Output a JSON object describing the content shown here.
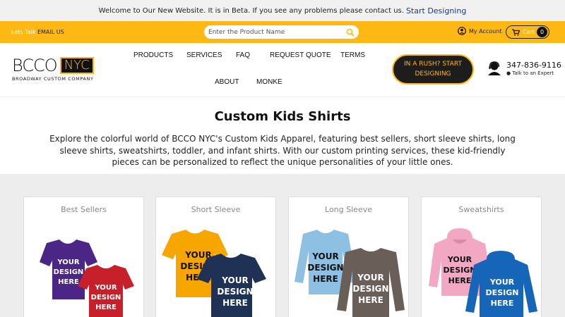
{
  "announcement": {
    "text": "Welcome to Our New Website. It is in Beta. If you see any problems please contact us.",
    "link": "Start Designing"
  },
  "utility": {
    "talk_prefix": "Lets Talk",
    "talk_link": "EMAIL US",
    "search_placeholder": "Enter the Product Name",
    "account": "My Account",
    "cart_label": "Cart",
    "cart_count": "0"
  },
  "logo": {
    "main": "BCCO",
    "accent": "NYC",
    "sub": "BROADWAY CUSTOM COMPANY"
  },
  "nav": {
    "products": "PRODUCTS",
    "services": "SERVICES",
    "faq": "FAQ",
    "request_quote": "REQUEST QUOTE",
    "terms": "TERMS",
    "about": "ABOUT",
    "monke": "MONKE"
  },
  "rush_button": {
    "line1": "IN A RUSH? START",
    "line2": "DESIGNING"
  },
  "phone": {
    "number": "347-836-9116",
    "expert": "● Talk to an Expert"
  },
  "intro": {
    "title": "Custom Kids Shirts",
    "body": "Explore the colorful world of BCCO NYC's Custom Kids Apparel, featuring best sellers, short sleeve shirts, long sleeve shirts, sweatshirts, toddler, and infant shirts. With our custom printing services, these kid-friendly pieces can be personalized to reflect the unique personalities of your little ones."
  },
  "cards": [
    {
      "title": "Best Sellers"
    },
    {
      "title": "Short Sleeve"
    },
    {
      "title": "Long Sleeve"
    },
    {
      "title": "Sweatshirts"
    }
  ],
  "shirt_print": {
    "l1": "YOUR",
    "l2": "DESIGN",
    "l3": "HERE"
  },
  "colors": {
    "brand_yellow": "#fdb813",
    "dark": "#1d1d1d",
    "link_blue": "#1a3a8a"
  }
}
